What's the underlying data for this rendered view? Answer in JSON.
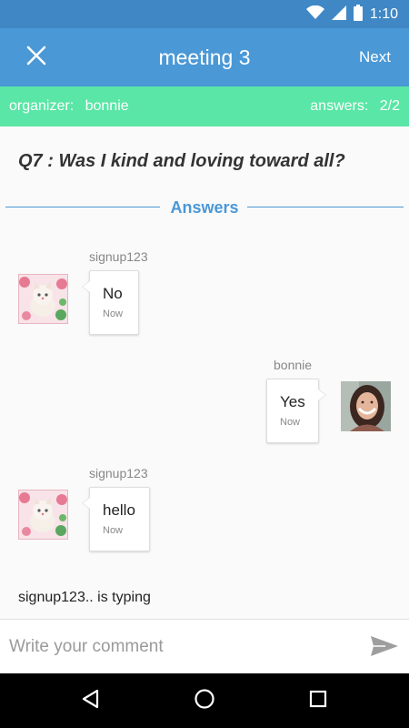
{
  "status_bar": {
    "time": "1:10",
    "icons": [
      "wifi-icon",
      "cell-signal-icon",
      "battery-icon"
    ]
  },
  "toolbar": {
    "title": "meeting 3",
    "next_label": "Next",
    "close_icon": "close-icon"
  },
  "info_bar": {
    "organizer_label": "organizer:",
    "organizer_value": "bonnie",
    "answers_label": "answers:",
    "answers_value": "2/2"
  },
  "question": "Q7 : Was I kind and loving toward all?",
  "answers_label": "Answers",
  "messages": [
    {
      "sender": "signup123",
      "text": "No",
      "time": "Now",
      "side": "left",
      "avatar": "kitten-avatar"
    },
    {
      "sender": "bonnie",
      "text": "Yes",
      "time": "Now",
      "side": "right",
      "avatar": "woman-avatar"
    },
    {
      "sender": "signup123",
      "text": "hello",
      "time": "Now",
      "side": "left",
      "avatar": "kitten-avatar"
    }
  ],
  "typing_status": "signup123.. is typing",
  "comment": {
    "placeholder": "Write your comment",
    "value": ""
  },
  "colors": {
    "status_bar": "#3f88c5",
    "toolbar": "#4a98d6",
    "info_bar": "#5ae6a6",
    "accent": "#4a98d6"
  }
}
